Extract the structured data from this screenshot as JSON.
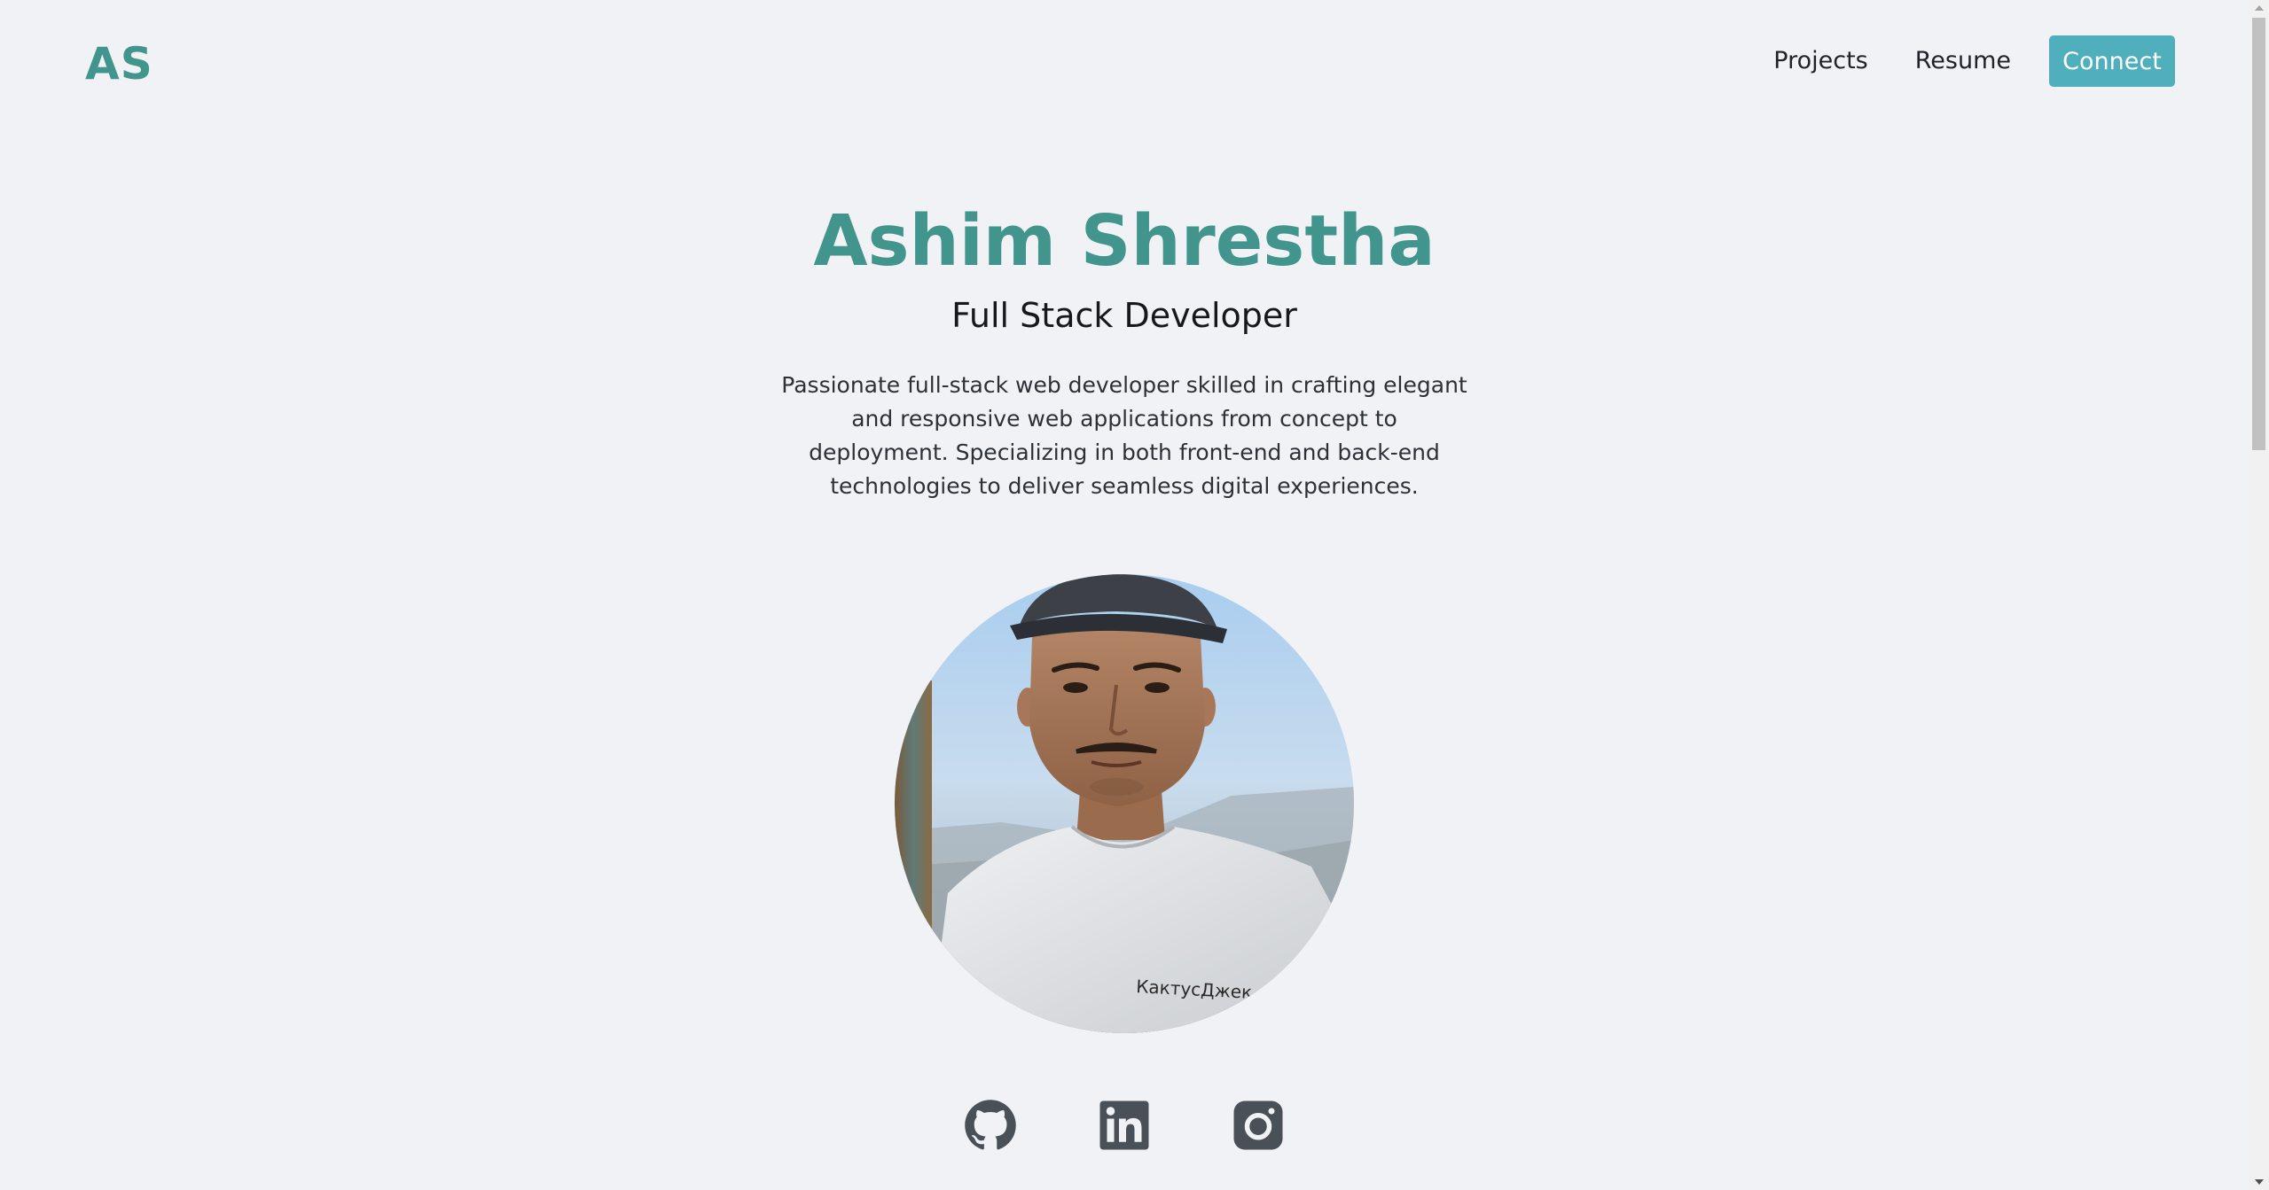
{
  "header": {
    "logo": "AS",
    "nav": {
      "projects": "Projects",
      "resume": "Resume",
      "connect": "Connect"
    }
  },
  "hero": {
    "name": "Ashim Shrestha",
    "role": "Full Stack Developer",
    "bio": "Passionate full-stack web developer skilled in crafting elegant and responsive web applications from concept to deployment. Specializing in both front-end and back-end technologies to deliver seamless digital experiences.",
    "shirt_text": "КактусДжек"
  },
  "socials": [
    {
      "icon": "github-icon"
    },
    {
      "icon": "linkedin-icon"
    },
    {
      "icon": "instagram-icon"
    }
  ],
  "colors": {
    "brand": "#41958c",
    "connect_button": "#4fafbd",
    "background": "#f1f2f5",
    "icon": "#4a5058"
  }
}
